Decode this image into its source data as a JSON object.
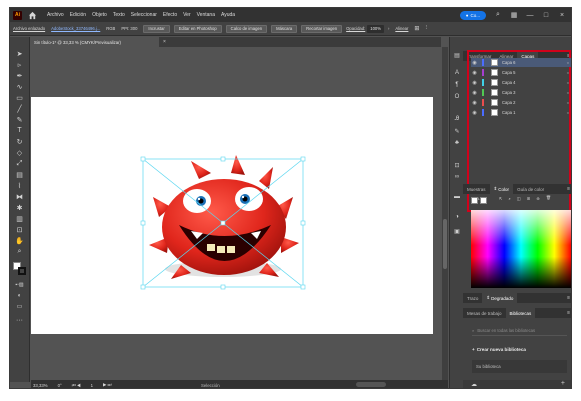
{
  "menubar": {
    "logo": "Ai",
    "items": [
      "Archivo",
      "Edición",
      "Objeto",
      "Texto",
      "Seleccionar",
      "Efecto",
      "Ver",
      "Ventana",
      "Ayuda"
    ],
    "share_label": "Co..."
  },
  "control_bar": {
    "object_type": "Archivo enlazado",
    "file_name": "AdobeStock_33746496.j...",
    "color_mode": "RGB",
    "ppi": "PPI: 300",
    "buttons": [
      "Incrustar",
      "Editar en Photoshop",
      "Calco de imagen",
      "Máscara",
      "Recortar imagen"
    ],
    "opacity_label": "Opacidad:",
    "opacity_value": "100%",
    "align_label": "Alinear"
  },
  "document": {
    "tab_title": "Sin título-1* @ 33,33 % (CMYK/Previsualizar)",
    "close_glyph": "×"
  },
  "status": {
    "zoom": "33,33%",
    "rotation": "0°",
    "artboard": "1",
    "tool": "Selección"
  },
  "panels": {
    "top_tabs": [
      "Transformar",
      "Alinear",
      "Capas"
    ],
    "active_top_tab": "Capas",
    "layers": [
      {
        "name": "Capa 6",
        "color": "#4b6dff",
        "selected": true
      },
      {
        "name": "Capa 5",
        "color": "#a63ecf",
        "selected": false
      },
      {
        "name": "Capa 4",
        "color": "#3fd1e6",
        "selected": false
      },
      {
        "name": "Capa 3",
        "color": "#50c852",
        "selected": false
      },
      {
        "name": "Capa 2",
        "color": "#e84d4d",
        "selected": false
      },
      {
        "name": "Capa 1",
        "color": "#4a6cff",
        "selected": false
      }
    ],
    "layers_count": "6 ca...",
    "color_tabs": [
      "Muestras",
      "Color",
      "Guía de color"
    ],
    "active_color_tab": "Color",
    "gradient_tabs": [
      "Trazo",
      "Degradado"
    ],
    "active_gradient_tab": "Degradado",
    "library_tabs": [
      "Mesas de trabajo",
      "Bibliotecas"
    ],
    "active_library_tab": "Bibliotecas",
    "library_search_placeholder": "Buscar en todas las bibliotecas",
    "create_library": "Crear nueva biblioteca",
    "your_library": "Su biblioteca"
  },
  "accent_color": "#1473e6",
  "highlight_color": "#d0021b"
}
